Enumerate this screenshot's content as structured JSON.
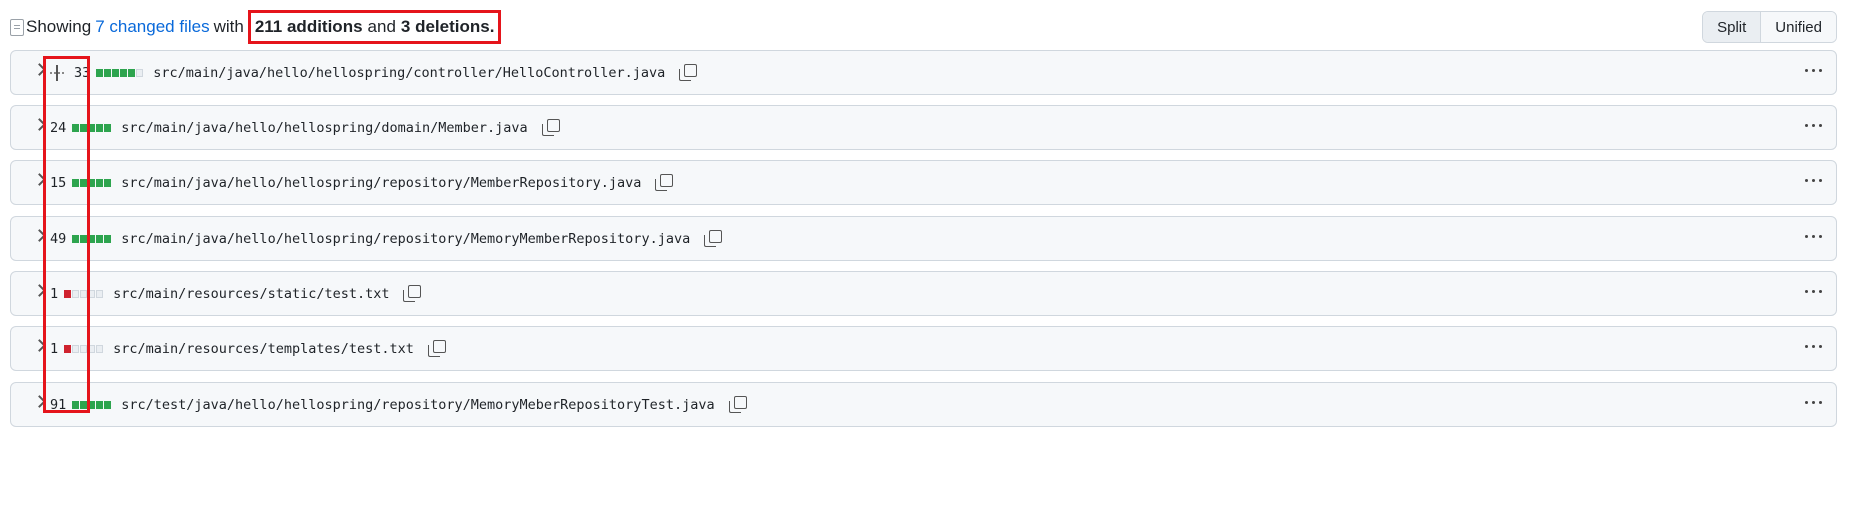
{
  "summary": {
    "prefix": "Showing",
    "changed_files": "7 changed files",
    "with": "with",
    "additions": "211 additions",
    "and": "and",
    "deletions": "3 deletions."
  },
  "view_toggle": {
    "split": "Split",
    "unified": "Unified"
  },
  "files": [
    {
      "count": "33",
      "path": "src/main/java/hello/hellospring/controller/HelloController.java",
      "bar": [
        "add",
        "add",
        "add",
        "add",
        "add",
        "neutral"
      ]
    },
    {
      "count": "24",
      "path": "src/main/java/hello/hellospring/domain/Member.java",
      "bar": [
        "add",
        "add",
        "add",
        "add",
        "add"
      ]
    },
    {
      "count": "15",
      "path": "src/main/java/hello/hellospring/repository/MemberRepository.java",
      "bar": [
        "add",
        "add",
        "add",
        "add",
        "add"
      ]
    },
    {
      "count": "49",
      "path": "src/main/java/hello/hellospring/repository/MemoryMemberRepository.java",
      "bar": [
        "add",
        "add",
        "add",
        "add",
        "add"
      ]
    },
    {
      "count": "1",
      "path": "src/main/resources/static/test.txt",
      "bar": [
        "del",
        "neutral",
        "neutral",
        "neutral",
        "neutral"
      ]
    },
    {
      "count": "1",
      "path": "src/main/resources/templates/test.txt",
      "bar": [
        "del",
        "neutral",
        "neutral",
        "neutral",
        "neutral"
      ]
    },
    {
      "count": "91",
      "path": "src/test/java/hello/hellospring/repository/MemoryMeberRepositoryTest.java",
      "bar": [
        "add",
        "add",
        "add",
        "add",
        "add"
      ]
    }
  ],
  "colors": {
    "addition": "#2da44e",
    "deletion": "#cf222e",
    "highlight": "#e5141b",
    "link": "#0969da"
  }
}
